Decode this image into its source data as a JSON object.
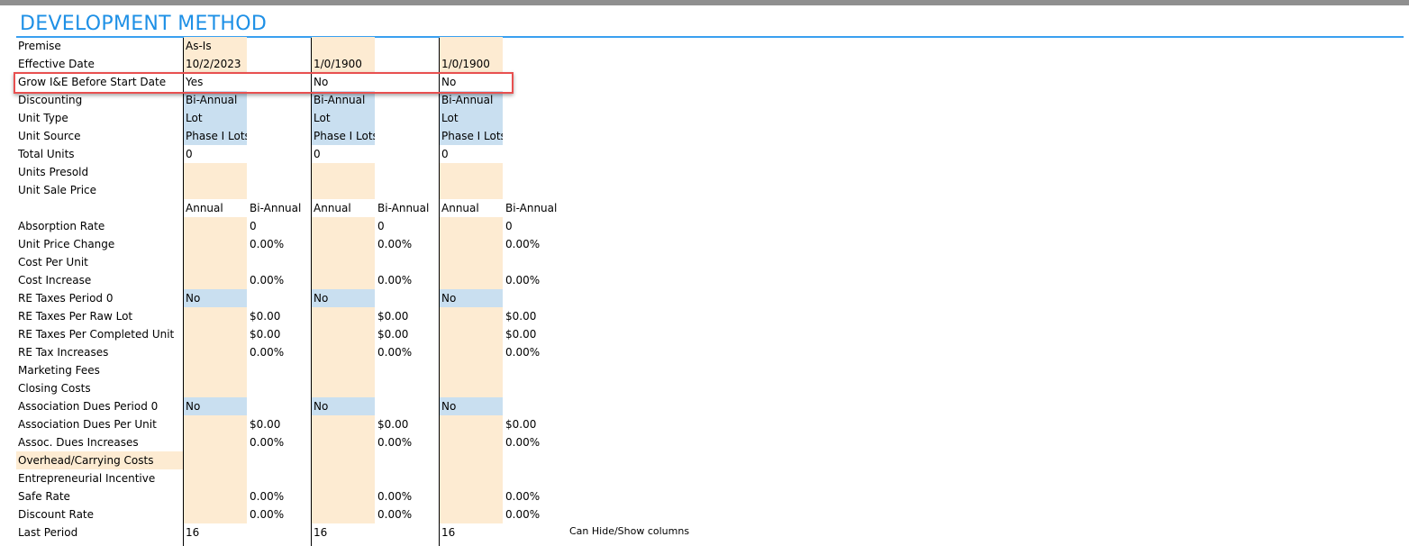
{
  "title": "DEVELOPMENT METHOD",
  "note": "Can Hide/Show columns",
  "sub_headers": {
    "annual": "Annual",
    "bi_annual": "Bi-Annual"
  },
  "rows": [
    {
      "key": "premise",
      "label": "Premise",
      "kind": "single",
      "vals": [
        "As-Is",
        "",
        ""
      ],
      "fill": "cream"
    },
    {
      "key": "effective-date",
      "label": "Effective Date",
      "kind": "single",
      "vals": [
        "10/2/2023",
        "1/0/1900",
        "1/0/1900"
      ],
      "fill": "cream"
    },
    {
      "key": "grow-ie",
      "label": "Grow I&E Before Start Date",
      "kind": "single",
      "vals": [
        "Yes",
        "No",
        "No"
      ],
      "fill": "none"
    },
    {
      "key": "discounting",
      "label": "Discounting",
      "kind": "single",
      "vals": [
        "Bi-Annual",
        "Bi-Annual",
        "Bi-Annual"
      ],
      "fill": "blue"
    },
    {
      "key": "unit-type",
      "label": "Unit Type",
      "kind": "single",
      "vals": [
        "Lot",
        "Lot",
        "Lot"
      ],
      "fill": "blue"
    },
    {
      "key": "unit-source",
      "label": "Unit Source",
      "kind": "single",
      "vals": [
        "Phase I Lots",
        "Phase I Lots",
        "Phase I Lots"
      ],
      "fill": "blue"
    },
    {
      "key": "total-units",
      "label": "Total Units",
      "kind": "single",
      "vals": [
        "0",
        "0",
        "0"
      ],
      "fill": "none"
    },
    {
      "key": "units-presold",
      "label": "Units Presold",
      "kind": "single",
      "vals": [
        "",
        "",
        ""
      ],
      "fill": "cream"
    },
    {
      "key": "unit-sale-price",
      "label": "Unit Sale Price",
      "kind": "single",
      "vals": [
        "",
        "",
        ""
      ],
      "fill": "cream"
    },
    {
      "key": "period-header",
      "label": "",
      "kind": "header"
    },
    {
      "key": "absorption-rate",
      "label": "Absorption Rate",
      "kind": "pair",
      "a": [
        "",
        "",
        ""
      ],
      "b": [
        "0",
        "0",
        "0"
      ]
    },
    {
      "key": "unit-price-change",
      "label": "Unit Price Change",
      "kind": "pair",
      "a": [
        "",
        "",
        ""
      ],
      "b": [
        "0.00%",
        "0.00%",
        "0.00%"
      ]
    },
    {
      "key": "cost-per-unit",
      "label": "Cost Per Unit",
      "kind": "pair",
      "a": [
        "",
        "",
        ""
      ],
      "b": [
        "",
        "",
        ""
      ]
    },
    {
      "key": "cost-increase",
      "label": "Cost Increase",
      "kind": "pair",
      "a": [
        "",
        "",
        ""
      ],
      "b": [
        "0.00%",
        "0.00%",
        "0.00%"
      ]
    },
    {
      "key": "re-taxes-period-0",
      "label": "RE Taxes Period 0",
      "kind": "single",
      "vals": [
        "No",
        "No",
        "No"
      ],
      "fill": "blue"
    },
    {
      "key": "re-taxes-raw-lot",
      "label": "RE Taxes Per Raw Lot",
      "kind": "pair",
      "a": [
        "",
        "",
        ""
      ],
      "b": [
        "$0.00",
        "$0.00",
        "$0.00"
      ]
    },
    {
      "key": "re-taxes-completed",
      "label": "RE Taxes Per Completed Unit",
      "kind": "pair",
      "a": [
        "",
        "",
        ""
      ],
      "b": [
        "$0.00",
        "$0.00",
        "$0.00"
      ]
    },
    {
      "key": "re-tax-increases",
      "label": "RE Tax Increases",
      "kind": "pair",
      "a": [
        "",
        "",
        ""
      ],
      "b": [
        "0.00%",
        "0.00%",
        "0.00%"
      ]
    },
    {
      "key": "marketing-fees",
      "label": "Marketing Fees",
      "kind": "pair",
      "a": [
        "",
        "",
        ""
      ],
      "b": [
        "",
        "",
        ""
      ]
    },
    {
      "key": "closing-costs",
      "label": "Closing Costs",
      "kind": "pair",
      "a": [
        "",
        "",
        ""
      ],
      "b": [
        "",
        "",
        ""
      ]
    },
    {
      "key": "assoc-dues-period-0",
      "label": "Association Dues Period 0",
      "kind": "single",
      "vals": [
        "No",
        "No",
        "No"
      ],
      "fill": "blue"
    },
    {
      "key": "assoc-dues-per-unit",
      "label": "Association Dues Per Unit",
      "kind": "pair",
      "a": [
        "",
        "",
        ""
      ],
      "b": [
        "$0.00",
        "$0.00",
        "$0.00"
      ]
    },
    {
      "key": "assoc-dues-increases",
      "label": "Assoc. Dues Increases",
      "kind": "pair",
      "a": [
        "",
        "",
        ""
      ],
      "b": [
        "0.00%",
        "0.00%",
        "0.00%"
      ]
    },
    {
      "key": "overhead-carrying",
      "label": "Overhead/Carrying Costs",
      "kind": "pair",
      "label_hl": true,
      "a": [
        "",
        "",
        ""
      ],
      "b": [
        "",
        "",
        ""
      ]
    },
    {
      "key": "entrepreneurial-incentive",
      "label": "Entrepreneurial Incentive",
      "kind": "pair",
      "a": [
        "",
        "",
        ""
      ],
      "b": [
        "",
        "",
        ""
      ]
    },
    {
      "key": "safe-rate",
      "label": "Safe Rate",
      "kind": "pair",
      "a": [
        "",
        "",
        ""
      ],
      "b": [
        "0.00%",
        "0.00%",
        "0.00%"
      ]
    },
    {
      "key": "discount-rate",
      "label": "Discount Rate",
      "kind": "pair",
      "a": [
        "",
        "",
        ""
      ],
      "b": [
        "0.00%",
        "0.00%",
        "0.00%"
      ]
    },
    {
      "key": "last-period",
      "label": "Last Period",
      "kind": "single",
      "vals": [
        "16",
        "16",
        "16"
      ],
      "fill": "none"
    }
  ]
}
